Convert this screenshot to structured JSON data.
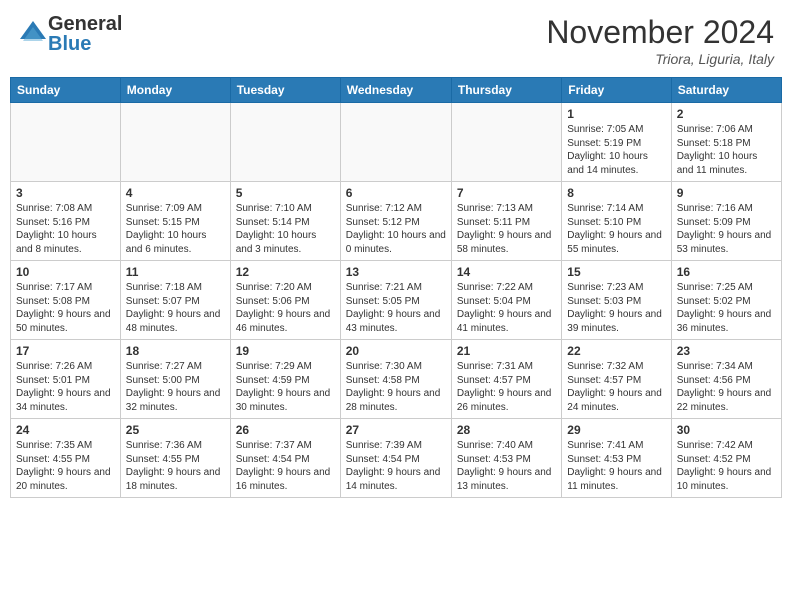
{
  "header": {
    "logo_general": "General",
    "logo_blue": "Blue",
    "month_title": "November 2024",
    "location": "Triora, Liguria, Italy"
  },
  "days_of_week": [
    "Sunday",
    "Monday",
    "Tuesday",
    "Wednesday",
    "Thursday",
    "Friday",
    "Saturday"
  ],
  "weeks": [
    [
      {
        "day": "",
        "info": ""
      },
      {
        "day": "",
        "info": ""
      },
      {
        "day": "",
        "info": ""
      },
      {
        "day": "",
        "info": ""
      },
      {
        "day": "",
        "info": ""
      },
      {
        "day": "1",
        "info": "Sunrise: 7:05 AM\nSunset: 5:19 PM\nDaylight: 10 hours and 14 minutes."
      },
      {
        "day": "2",
        "info": "Sunrise: 7:06 AM\nSunset: 5:18 PM\nDaylight: 10 hours and 11 minutes."
      }
    ],
    [
      {
        "day": "3",
        "info": "Sunrise: 7:08 AM\nSunset: 5:16 PM\nDaylight: 10 hours and 8 minutes."
      },
      {
        "day": "4",
        "info": "Sunrise: 7:09 AM\nSunset: 5:15 PM\nDaylight: 10 hours and 6 minutes."
      },
      {
        "day": "5",
        "info": "Sunrise: 7:10 AM\nSunset: 5:14 PM\nDaylight: 10 hours and 3 minutes."
      },
      {
        "day": "6",
        "info": "Sunrise: 7:12 AM\nSunset: 5:12 PM\nDaylight: 10 hours and 0 minutes."
      },
      {
        "day": "7",
        "info": "Sunrise: 7:13 AM\nSunset: 5:11 PM\nDaylight: 9 hours and 58 minutes."
      },
      {
        "day": "8",
        "info": "Sunrise: 7:14 AM\nSunset: 5:10 PM\nDaylight: 9 hours and 55 minutes."
      },
      {
        "day": "9",
        "info": "Sunrise: 7:16 AM\nSunset: 5:09 PM\nDaylight: 9 hours and 53 minutes."
      }
    ],
    [
      {
        "day": "10",
        "info": "Sunrise: 7:17 AM\nSunset: 5:08 PM\nDaylight: 9 hours and 50 minutes."
      },
      {
        "day": "11",
        "info": "Sunrise: 7:18 AM\nSunset: 5:07 PM\nDaylight: 9 hours and 48 minutes."
      },
      {
        "day": "12",
        "info": "Sunrise: 7:20 AM\nSunset: 5:06 PM\nDaylight: 9 hours and 46 minutes."
      },
      {
        "day": "13",
        "info": "Sunrise: 7:21 AM\nSunset: 5:05 PM\nDaylight: 9 hours and 43 minutes."
      },
      {
        "day": "14",
        "info": "Sunrise: 7:22 AM\nSunset: 5:04 PM\nDaylight: 9 hours and 41 minutes."
      },
      {
        "day": "15",
        "info": "Sunrise: 7:23 AM\nSunset: 5:03 PM\nDaylight: 9 hours and 39 minutes."
      },
      {
        "day": "16",
        "info": "Sunrise: 7:25 AM\nSunset: 5:02 PM\nDaylight: 9 hours and 36 minutes."
      }
    ],
    [
      {
        "day": "17",
        "info": "Sunrise: 7:26 AM\nSunset: 5:01 PM\nDaylight: 9 hours and 34 minutes."
      },
      {
        "day": "18",
        "info": "Sunrise: 7:27 AM\nSunset: 5:00 PM\nDaylight: 9 hours and 32 minutes."
      },
      {
        "day": "19",
        "info": "Sunrise: 7:29 AM\nSunset: 4:59 PM\nDaylight: 9 hours and 30 minutes."
      },
      {
        "day": "20",
        "info": "Sunrise: 7:30 AM\nSunset: 4:58 PM\nDaylight: 9 hours and 28 minutes."
      },
      {
        "day": "21",
        "info": "Sunrise: 7:31 AM\nSunset: 4:57 PM\nDaylight: 9 hours and 26 minutes."
      },
      {
        "day": "22",
        "info": "Sunrise: 7:32 AM\nSunset: 4:57 PM\nDaylight: 9 hours and 24 minutes."
      },
      {
        "day": "23",
        "info": "Sunrise: 7:34 AM\nSunset: 4:56 PM\nDaylight: 9 hours and 22 minutes."
      }
    ],
    [
      {
        "day": "24",
        "info": "Sunrise: 7:35 AM\nSunset: 4:55 PM\nDaylight: 9 hours and 20 minutes."
      },
      {
        "day": "25",
        "info": "Sunrise: 7:36 AM\nSunset: 4:55 PM\nDaylight: 9 hours and 18 minutes."
      },
      {
        "day": "26",
        "info": "Sunrise: 7:37 AM\nSunset: 4:54 PM\nDaylight: 9 hours and 16 minutes."
      },
      {
        "day": "27",
        "info": "Sunrise: 7:39 AM\nSunset: 4:54 PM\nDaylight: 9 hours and 14 minutes."
      },
      {
        "day": "28",
        "info": "Sunrise: 7:40 AM\nSunset: 4:53 PM\nDaylight: 9 hours and 13 minutes."
      },
      {
        "day": "29",
        "info": "Sunrise: 7:41 AM\nSunset: 4:53 PM\nDaylight: 9 hours and 11 minutes."
      },
      {
        "day": "30",
        "info": "Sunrise: 7:42 AM\nSunset: 4:52 PM\nDaylight: 9 hours and 10 minutes."
      }
    ]
  ]
}
